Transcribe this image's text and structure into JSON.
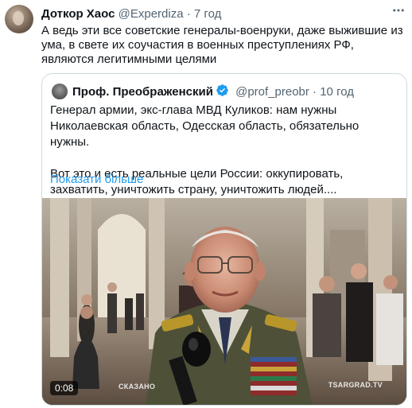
{
  "tweet": {
    "author_name": "Доткор Хаос",
    "author_handle": "@Experdiza",
    "separator": "·",
    "time": "7 год",
    "more_icon": "more-icon",
    "text": "А ведь эти все советские генералы-военруки, даже выжившие из ума, в свете их соучастия в военных преступлениях РФ, являются легитимными целями"
  },
  "quote": {
    "author_name": "Проф. Преображенский",
    "author_handle": "@prof_preobr",
    "separator": "·",
    "time": "10 год",
    "verified_icon": "verified-badge-icon",
    "paragraph_1": "Генерал армии, экс-глава МВД Куликов: нам нужны Николаевская область, Одесская область, обязательно нужны.",
    "paragraph_2": "Вот это и есть реальные цели России: оккупировать, захватить, уничтожить страну, уничтожить людей....",
    "show_more": "Показати більше"
  },
  "video": {
    "timer": "0:08",
    "watermark_left": "СКАЗАНО",
    "watermark_right": "TSARGRAD.TV"
  },
  "colors": {
    "text": "#0f1419",
    "secondary": "#536471",
    "link": "#1d9bf0",
    "border": "#cfd9de"
  }
}
